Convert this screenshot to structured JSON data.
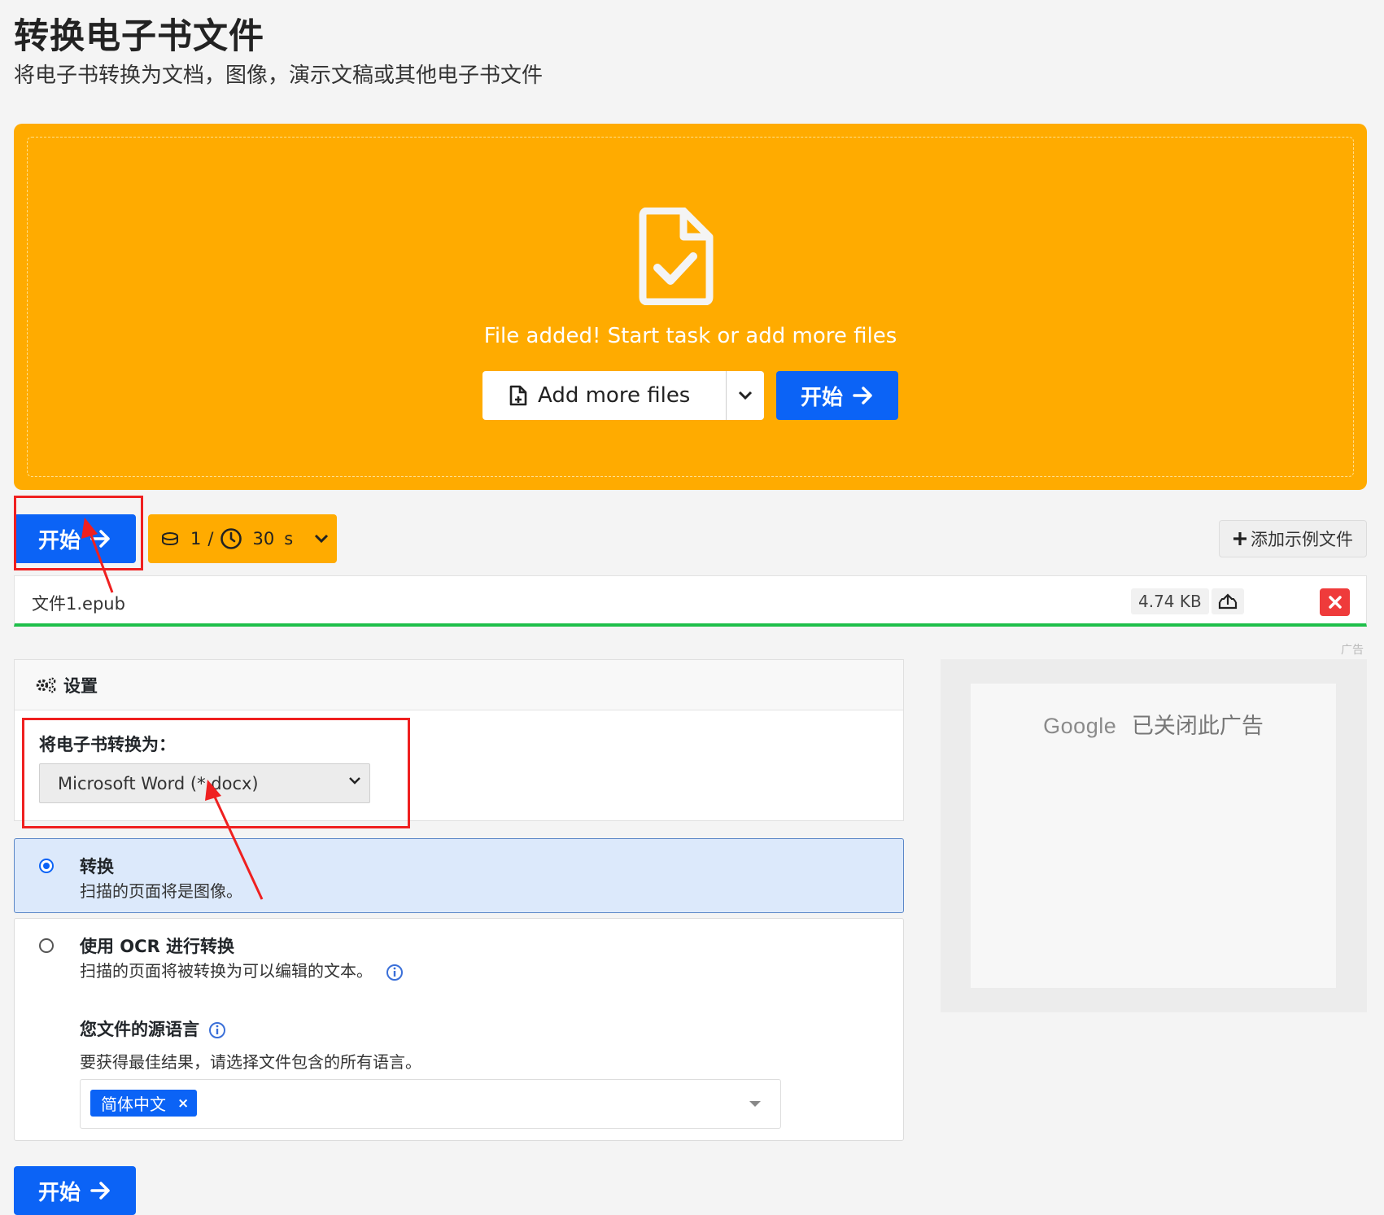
{
  "header": {
    "title": "转换电子书文件",
    "subtitle": "将电子书转换为文档，图像，演示文稿或其他电子书文件"
  },
  "dropzone": {
    "message": "File added! Start task or add more files",
    "add_files_label": "Add more files",
    "start_label": "开始"
  },
  "toolbar": {
    "start_label": "开始",
    "credits_count": "1",
    "credits_separator": "/",
    "time_value": "30",
    "time_unit": "s",
    "add_sample_label": "添加示例文件"
  },
  "file": {
    "name": "文件1.epub",
    "size": "4.74 KB",
    "progress": 1.0
  },
  "settings": {
    "header": "设置",
    "convert_label": "将电子书转换为：",
    "format_selected": "Microsoft Word (*.docx)"
  },
  "options": [
    {
      "title": "转换",
      "desc": "扫描的页面将是图像。",
      "selected": true
    },
    {
      "title": "使用 OCR 进行转换",
      "desc": "扫描的页面将被转换为可以编辑的文本。",
      "selected": false
    }
  ],
  "ocr_language": {
    "title": "您文件的源语言",
    "desc": "要获得最佳结果，请选择文件包含的所有语言。",
    "selected": [
      "简体中文"
    ]
  },
  "ad": {
    "label": "广告",
    "google": "Google",
    "closed_text": "已关闭此广告"
  },
  "bottom": {
    "start_label": "开始"
  },
  "colors": {
    "accent_blue": "#0b63f6",
    "dropzone_orange": "#ffab00",
    "progress_green": "#1fbf4a",
    "remove_red": "#ef3b3b",
    "annotation_red": "#ef2020"
  }
}
